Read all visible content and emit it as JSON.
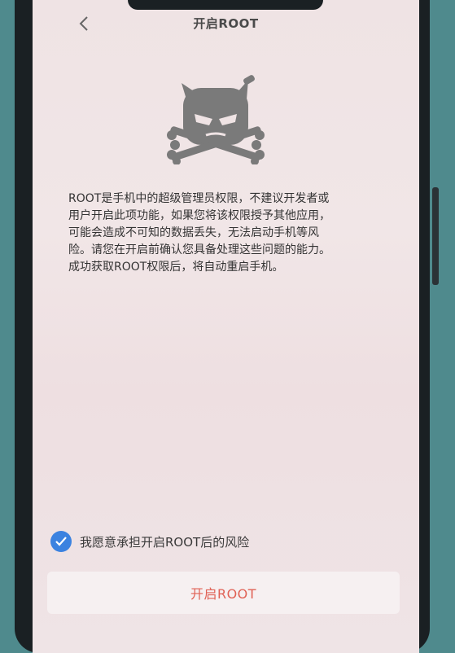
{
  "header": {
    "title": "开启ROOT"
  },
  "description": "ROOT是手机中的超级管理员权限，不建议开发者或\n用户开启此项功能，如果您将该权限授予其他应用，\n可能会造成不可知的数据丢失，无法启动手机等风\n险。请您在开启前确认您具备处理这些问题的能力。\n成功获取ROOT权限后，将自动重启手机。",
  "agreement": {
    "label": "我愿意承担开启ROOT后的风险",
    "checked": true
  },
  "action": {
    "label": "开启ROOT"
  },
  "colors": {
    "accent": "#3b82e0",
    "danger": "#e06155"
  }
}
